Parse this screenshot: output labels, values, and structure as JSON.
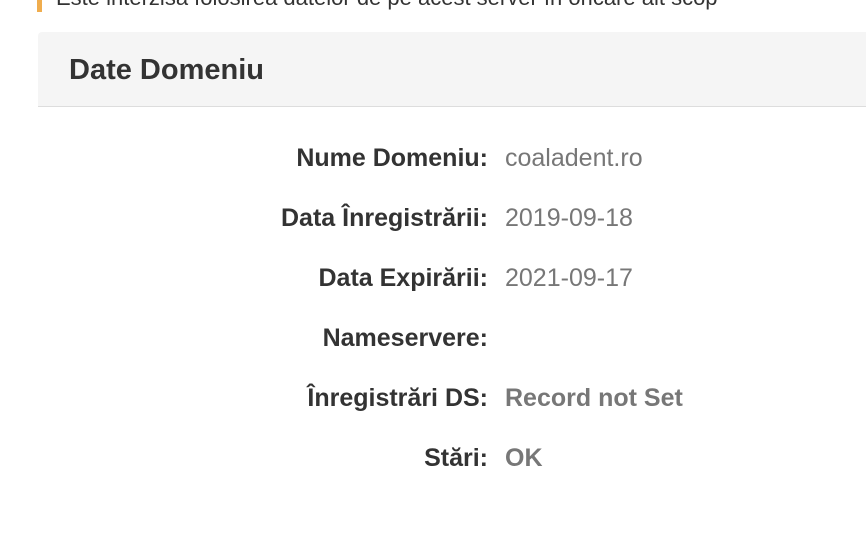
{
  "notice": {
    "text": "Este interzisă folosirea datelor de pe acest server în oricare alt scop"
  },
  "panel": {
    "title": "Date Domeniu",
    "rows": [
      {
        "label": "Nume Domeniu:",
        "value": "coaladent.ro"
      },
      {
        "label": "Data Înregistrării:",
        "value": "2019-09-18"
      },
      {
        "label": "Data Expirării:",
        "value": "2021-09-17"
      },
      {
        "label": "Nameservere:",
        "value": ""
      },
      {
        "label": "Înregistrări DS:",
        "value": "Record not Set"
      },
      {
        "label": "Stări:",
        "value": "OK"
      }
    ]
  },
  "colors": {
    "notice_border": "#f0ad4e",
    "heading_bg": "#f5f5f5",
    "label_text": "#333333",
    "value_text": "#777777"
  }
}
